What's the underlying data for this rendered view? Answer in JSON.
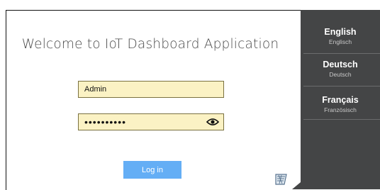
{
  "main": {
    "title": "Welcome to IoT Dashboard Application",
    "username_value": "Admin",
    "password_value": "••••••••••",
    "login_label": "Log in"
  },
  "languages": [
    {
      "name": "English",
      "sub": "Englisch"
    },
    {
      "name": "Deutsch",
      "sub": "Deutsch"
    },
    {
      "name": "Français",
      "sub": "Französisch"
    }
  ],
  "icons": {
    "password_toggle": "eye-icon",
    "corner_logo": "flag-icon"
  },
  "colors": {
    "input_bg": "#fbf2c4",
    "button_bg": "#64aef5",
    "panel_bg": "#444546"
  }
}
